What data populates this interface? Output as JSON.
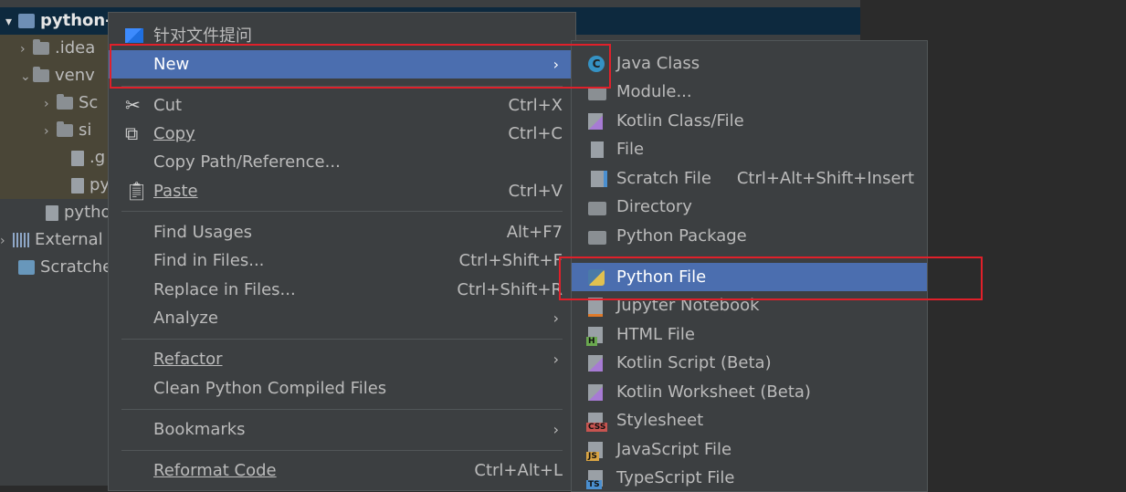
{
  "tree": {
    "root": "python-",
    "items": [
      {
        "label": ".idea",
        "arrow": "›"
      },
      {
        "label": "venv",
        "arrow": "⌄"
      },
      {
        "label": "Sc",
        "arrow": "›"
      },
      {
        "label": "si",
        "arrow": "›"
      },
      {
        "label": ".g",
        "arrow": ""
      },
      {
        "label": "py",
        "arrow": ""
      },
      {
        "label": "pytho",
        "arrow": ""
      },
      {
        "label": "External",
        "arrow": "›"
      },
      {
        "label": "Scratche",
        "arrow": ""
      }
    ]
  },
  "main_menu": {
    "header": "针对文件提问",
    "new": "New",
    "cut": "Cut",
    "cut_sc": "Ctrl+X",
    "copy": "Copy",
    "copy_sc": "Ctrl+C",
    "copy_path": "Copy Path/Reference...",
    "paste": "Paste",
    "paste_sc": "Ctrl+V",
    "find_usages": "Find Usages",
    "find_usages_sc": "Alt+F7",
    "find_in_files": "Find in Files...",
    "find_in_files_sc": "Ctrl+Shift+F",
    "replace_in_files": "Replace in Files...",
    "replace_in_files_sc": "Ctrl+Shift+R",
    "analyze": "Analyze",
    "refactor": "Refactor",
    "clean_python": "Clean Python Compiled Files",
    "bookmarks": "Bookmarks",
    "reformat": "Reformat Code",
    "reformat_sc": "Ctrl+Alt+L"
  },
  "sub_menu": {
    "java_class": "Java Class",
    "module": "Module...",
    "kotlin_class": "Kotlin Class/File",
    "file": "File",
    "scratch_file": "Scratch File",
    "scratch_sc": "Ctrl+Alt+Shift+Insert",
    "directory": "Directory",
    "python_package": "Python Package",
    "python_file": "Python File",
    "jupyter": "Jupyter Notebook",
    "html_file": "HTML File",
    "kotlin_script": "Kotlin Script (Beta)",
    "kotlin_worksheet": "Kotlin Worksheet (Beta)",
    "stylesheet": "Stylesheet",
    "javascript_file": "JavaScript File",
    "typescript_file": "TypeScript File",
    "tags": {
      "c": "C",
      "h": "H",
      "css": "CSS",
      "js": "JS",
      "ts": "TS"
    }
  },
  "colors": {
    "selection": "#4b6eaf",
    "annotation": "#e0202a"
  }
}
